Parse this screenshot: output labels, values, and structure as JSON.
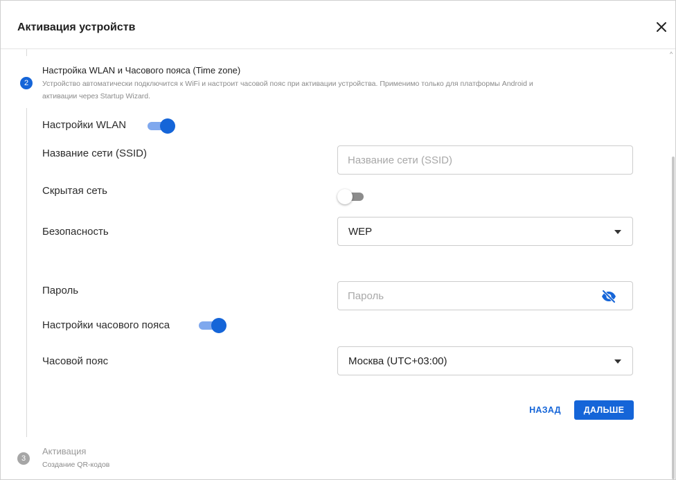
{
  "dialog": {
    "title": "Активация устройств"
  },
  "step2": {
    "number": "2",
    "title": "Настройка WLAN и Часового пояса (Time zone)",
    "description_line1": "Устройство автоматически подключится к WiFi и настроит часовой пояс при активации устройства. Применимо только для платформы Android и",
    "description_line2": "активации через Startup Wizard."
  },
  "wlan": {
    "section_label": "Настройки WLAN",
    "enabled": true,
    "ssid_label": "Название сети (SSID)",
    "ssid_placeholder": "Название сети (SSID)",
    "ssid_value": "",
    "hidden_label": "Скрытая сеть",
    "hidden_enabled": false,
    "security_label": "Безопасность",
    "security_value": "WEP",
    "password_label": "Пароль",
    "password_placeholder": "Пароль",
    "password_value": ""
  },
  "timezone": {
    "section_label": "Настройки часового пояса",
    "enabled": true,
    "tz_label": "Часовой пояс",
    "tz_value": "Москва (UTC+03:00)"
  },
  "actions": {
    "back_label": "НАЗАД",
    "next_label": "ДАЛЬШЕ"
  },
  "step3": {
    "number": "3",
    "title": "Активация",
    "description": "Создание QR-кодов"
  },
  "icons": {
    "close": "close-icon",
    "dropdown": "chevron-down-icon",
    "password_visibility": "eye-off-icon",
    "scroll": "chevron-up-icon"
  },
  "colors": {
    "accent": "#1565d8",
    "toggle_track_on": "#7fa8ee",
    "inactive_step": "#a6a6a6"
  }
}
